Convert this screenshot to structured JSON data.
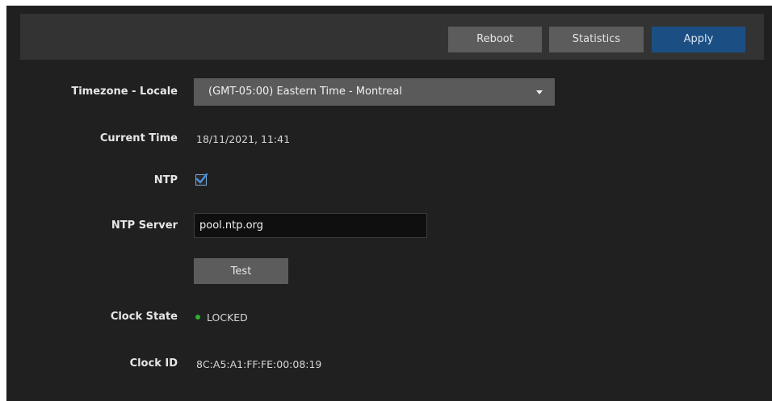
{
  "toolbar": {
    "reboot_label": "Reboot",
    "statistics_label": "Statistics",
    "apply_label": "Apply",
    "apply_color": "#1b4f83"
  },
  "form": {
    "timezone": {
      "label": "Timezone - Locale",
      "selected": "(GMT-05:00) Eastern Time - Montreal",
      "icon": "chevron-down-icon"
    },
    "current_time": {
      "label": "Current Time",
      "value": "18/11/2021, 11:41"
    },
    "ntp": {
      "label": "NTP",
      "checked": true,
      "icon": "checkmark-icon"
    },
    "ntp_server": {
      "label": "NTP Server",
      "value": "pool.ntp.org"
    },
    "test_label": "Test",
    "clock_state": {
      "label": "Clock State",
      "value": "LOCKED",
      "status_color": "#2fb12f",
      "icon": "status-dot-icon"
    },
    "clock_id": {
      "label": "Clock ID",
      "value": "8C:A5:A1:FF:FE:00:08:19"
    }
  }
}
